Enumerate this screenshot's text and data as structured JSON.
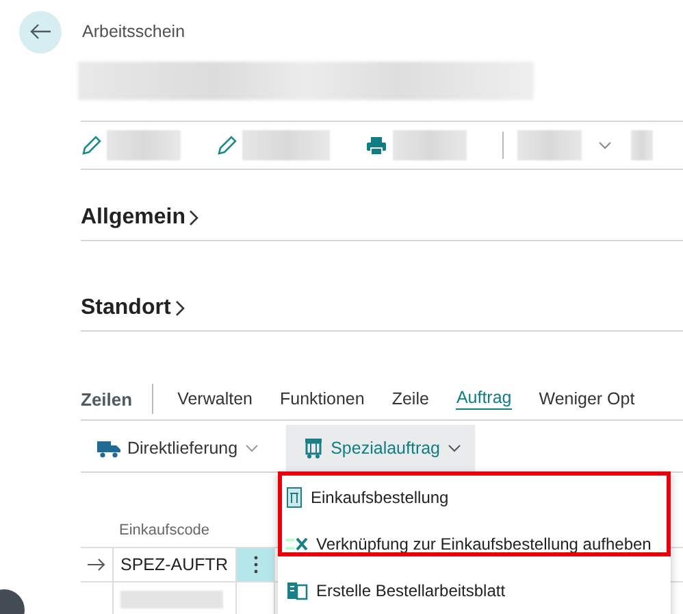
{
  "header": {
    "caption": "Arbeitsschein"
  },
  "sections": [
    {
      "title": "Allgemein"
    },
    {
      "title": "Standort"
    }
  ],
  "lines": {
    "title": "Zeilen",
    "tabs": [
      {
        "label": "Verwalten",
        "selected": false
      },
      {
        "label": "Funktionen",
        "selected": false
      },
      {
        "label": "Zeile",
        "selected": false
      },
      {
        "label": "Auftrag",
        "selected": true
      },
      {
        "label": "Weniger Opt",
        "selected": false
      }
    ],
    "actions": [
      {
        "kind": "truck",
        "label": "Direktlieferung",
        "expanded": false
      },
      {
        "kind": "cart",
        "label": "Spezialauftrag",
        "expanded": true
      }
    ],
    "columns": [
      "Einkaufscode"
    ],
    "rows": [
      {
        "code": "SPEZ-AUFTR",
        "current": true
      },
      {
        "current": false
      }
    ]
  },
  "menu": [
    {
      "kind": "order",
      "label": "Einkaufsbestellung"
    },
    {
      "kind": "unlink",
      "label": "Verknüpfung zur Einkaufsbestellung aufheben"
    },
    {
      "kind": "worksheet",
      "label": "Erstelle Bestellarbeitsblatt"
    }
  ]
}
